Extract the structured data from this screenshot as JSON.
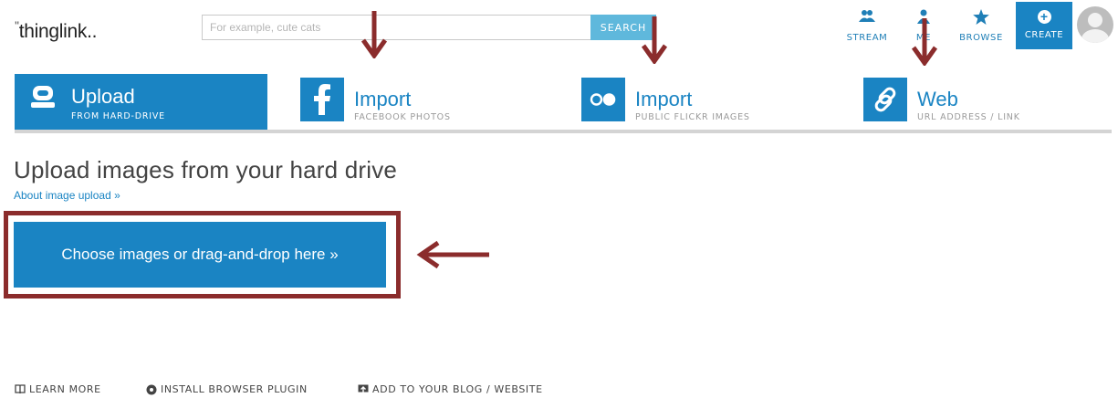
{
  "header": {
    "logo": "thinglink",
    "search": {
      "placeholder": "For example, cute cats",
      "value": "",
      "button_label": "SEARCH"
    },
    "nav": [
      {
        "label": "STREAM",
        "icon": "people-icon"
      },
      {
        "label": "ME",
        "icon": "person-icon"
      },
      {
        "label": "BROWSE",
        "icon": "star-icon"
      },
      {
        "label": "CREATE",
        "icon": "plus-circle-icon"
      }
    ]
  },
  "tabs": [
    {
      "title": "Upload",
      "subtitle": "FROM HARD-DRIVE",
      "icon": "harddrive-icon",
      "active": true
    },
    {
      "title": "Import",
      "subtitle": "FACEBOOK PHOTOS",
      "icon": "facebook-icon",
      "active": false
    },
    {
      "title": "Import",
      "subtitle": "PUBLIC FLICKR IMAGES",
      "icon": "flickr-icon",
      "active": false
    },
    {
      "title": "Web",
      "subtitle": "URL ADDRESS / LINK",
      "icon": "link-icon",
      "active": false
    }
  ],
  "main": {
    "title": "Upload images from your hard drive",
    "about_link": "About image upload »",
    "choose_button": "Choose images or drag-and-drop here »"
  },
  "footer": [
    {
      "label": "LEARN MORE",
      "icon": "book-icon"
    },
    {
      "label": "INSTALL BROWSER PLUGIN",
      "icon": "plugin-icon"
    },
    {
      "label": "ADD TO YOUR BLOG / WEBSITE",
      "icon": "embed-icon"
    }
  ],
  "colors": {
    "brand_blue": "#1a84c3",
    "search_button": "#5fb8dc",
    "annotation": "#8b2c2c",
    "tab_rule": "#d4d4d4"
  }
}
